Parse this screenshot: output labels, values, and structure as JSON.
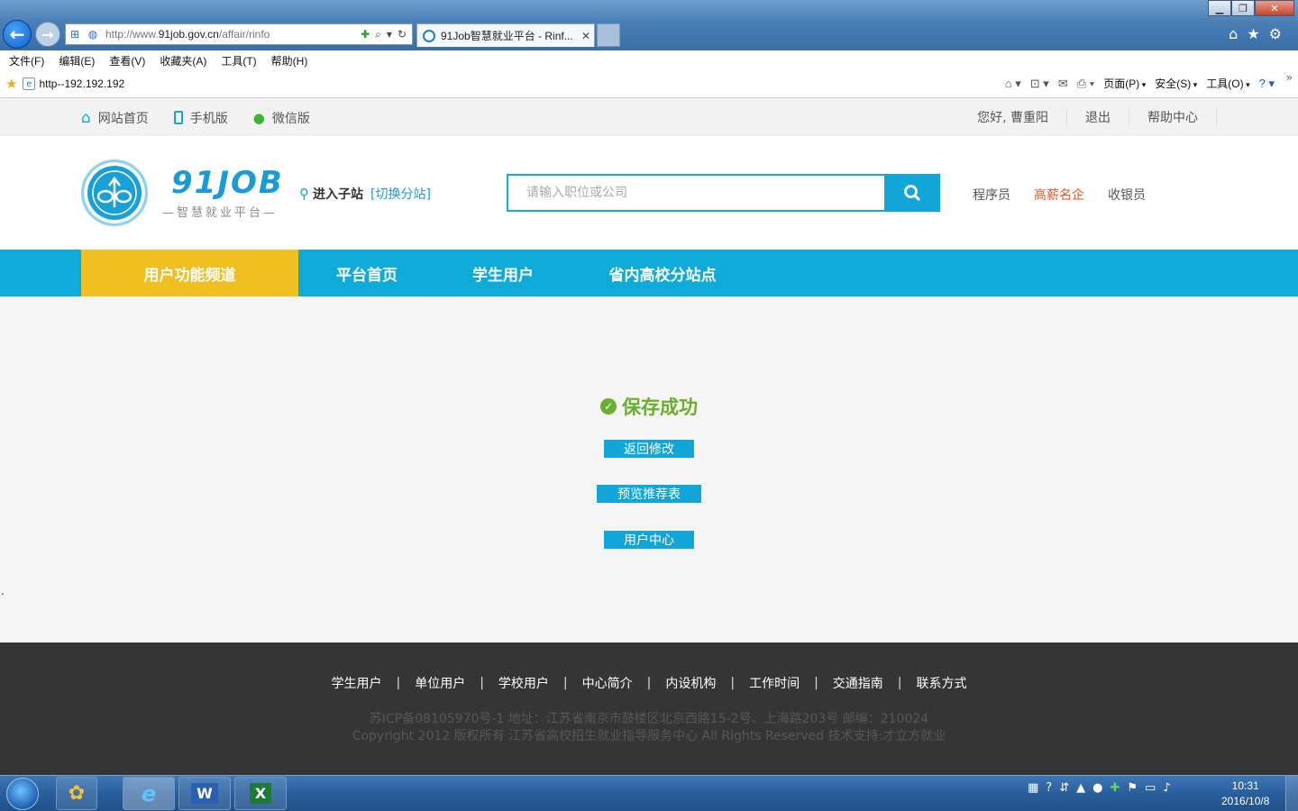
{
  "browser": {
    "address_prefix": "http://www.",
    "address_host": "91job.gov.cn",
    "address_path": "/affair/rinfo",
    "tab_title": "91Job智慧就业平台 - Rinf...",
    "menu": [
      "文件(F)",
      "编辑(E)",
      "查看(V)",
      "收藏夹(A)",
      "工具(T)",
      "帮助(H)"
    ],
    "favorite_link": "http--192.192.192",
    "command_bar": [
      "页面(P)",
      "安全(S)",
      "工具(O)"
    ]
  },
  "topstrip": {
    "home_label": "网站首页",
    "mobile_label": "手机版",
    "wechat_label": "微信版",
    "greeting": "您好, 曹重阳",
    "logout_label": "退出",
    "help_label": "帮助中心"
  },
  "header": {
    "logo_text": "91JOB",
    "logo_sub": "—智慧就业平台—",
    "substation_label": "进入子站",
    "switch_label": "[切换分站]",
    "search_placeholder": "请输入职位或公司",
    "hotwords": [
      "程序员",
      "高薪名企",
      "收银员"
    ],
    "hot_color": "#e2572a",
    "accent_color": "#12a6d8"
  },
  "nav": {
    "items": [
      "用户功能频道",
      "平台首页",
      "学生用户",
      "省内高校分站点"
    ],
    "active_color": "#f0bf22"
  },
  "content": {
    "success_text": "保存成功",
    "buttons": [
      "返回修改",
      "预览推荐表",
      "用户中心"
    ]
  },
  "footer": {
    "links": [
      "学生用户",
      "单位用户",
      "学校用户",
      "中心简介",
      "内设机构",
      "工作时间",
      "交通指南",
      "联系方式"
    ],
    "line1": "苏ICP备08105970号-1 地址：江苏省南京市鼓楼区北京西路15-2号、上海路203号 邮编：210024",
    "line2": "Copyright 2012 版权所有 江苏省高校招生就业指导服务中心 All Rights Reserved  技术支持:才立方就业"
  },
  "taskbar": {
    "time": "10:31",
    "date": "2016/10/8"
  }
}
